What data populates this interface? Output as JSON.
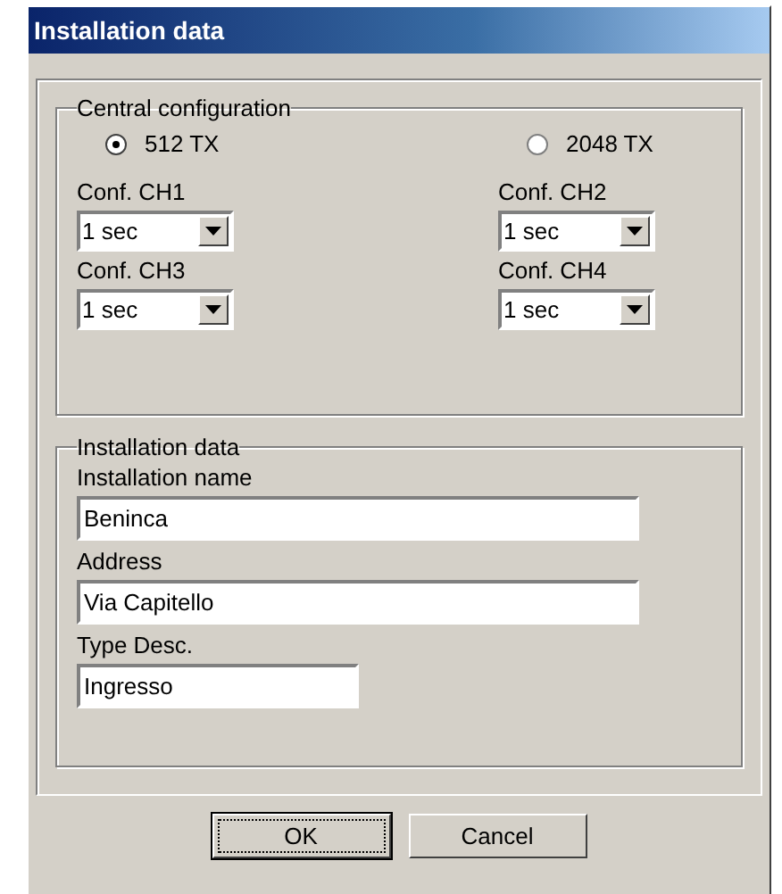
{
  "window": {
    "title": "Installation data"
  },
  "central_configuration": {
    "title": "Central configuration",
    "modes": [
      {
        "label": "512 TX",
        "selected": true
      },
      {
        "label": "2048 TX",
        "selected": false
      }
    ],
    "channels": [
      {
        "label": "Conf. CH1",
        "value": "1 sec"
      },
      {
        "label": "Conf. CH2",
        "value": "1 sec"
      },
      {
        "label": "Conf. CH3",
        "value": "1 sec"
      },
      {
        "label": "Conf. CH4",
        "value": "1 sec"
      }
    ]
  },
  "installation_data": {
    "title": "Installation data",
    "fields": [
      {
        "label": "Installation name",
        "value": "Beninca",
        "kind": "wide"
      },
      {
        "label": "Address",
        "value": "Via Capitello",
        "kind": "wide"
      },
      {
        "label": "Type Desc.",
        "value": "Ingresso",
        "kind": "narrow"
      }
    ]
  },
  "buttons": [
    {
      "label": "OK",
      "focused": true
    },
    {
      "label": "Cancel",
      "focused": false
    }
  ]
}
